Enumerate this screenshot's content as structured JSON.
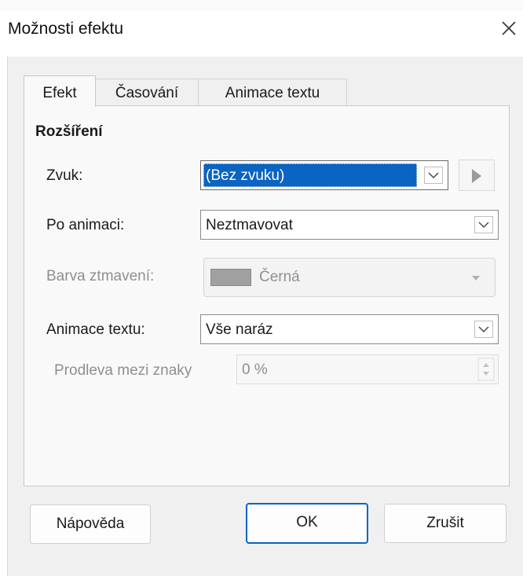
{
  "window": {
    "title": "Možnosti efektu",
    "close_icon": "close-icon"
  },
  "tabs": [
    {
      "label": "Efekt",
      "active": true
    },
    {
      "label": "Časování",
      "active": false
    },
    {
      "label": "Animace textu",
      "active": false
    }
  ],
  "section": {
    "title": "Rozšíření"
  },
  "fields": {
    "sound": {
      "label": "Zvuk:",
      "value": "(Bez zvuku)",
      "selected": true,
      "play_icon": "play-icon"
    },
    "after_animation": {
      "label": "Po animaci:",
      "value": "Neztmavovat"
    },
    "dim_color": {
      "label": "Barva ztmavení:",
      "value": "Černá",
      "swatch_color": "#a0a0a0",
      "disabled": true
    },
    "animate_text": {
      "label": "Animace textu:",
      "value": "Vše naráz"
    },
    "delay": {
      "label": "Prodleva mezi znaky",
      "value": "0 %",
      "disabled": true
    }
  },
  "buttons": {
    "help": "Nápověda",
    "ok": "OK",
    "cancel": "Zrušit"
  },
  "colors": {
    "accent": "#0a64c2",
    "dialog_bg": "#f0f0f0",
    "panel_bg": "#f9f9f9",
    "disabled_text": "#8f8f8f"
  }
}
